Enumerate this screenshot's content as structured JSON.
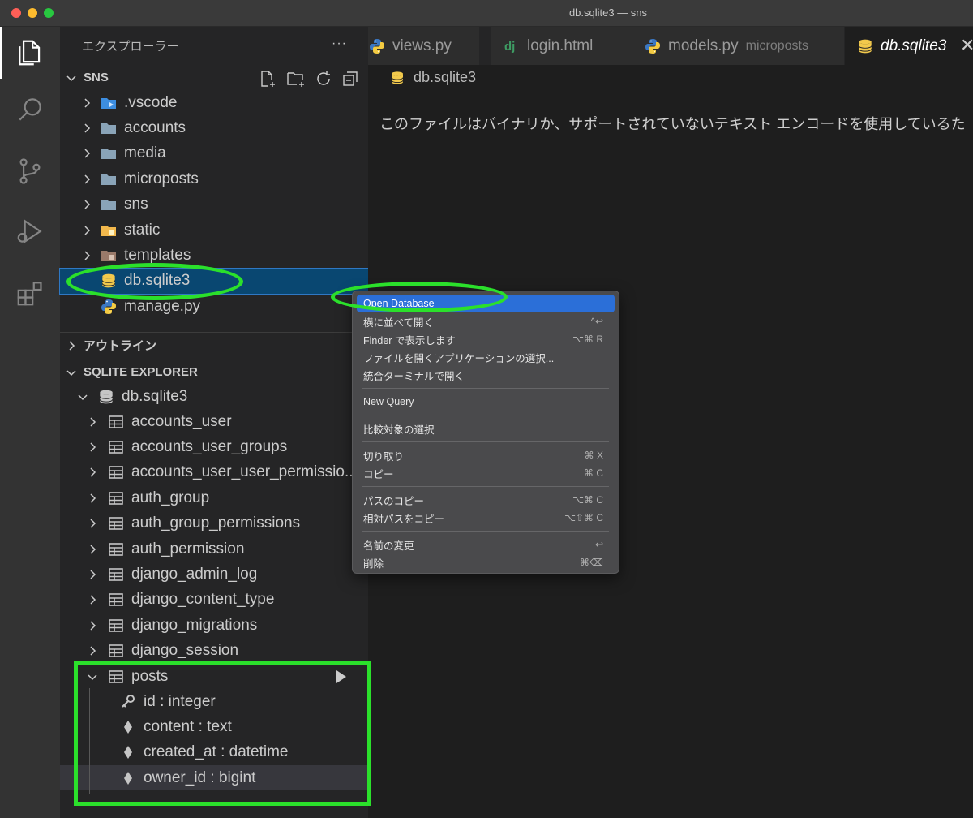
{
  "window": {
    "title": "db.sqlite3 — sns"
  },
  "sidebar": {
    "explorer_title": "エクスプローラー",
    "more": "···",
    "workspace": "SNS",
    "tree": [
      {
        "label": ".vscode",
        "kind": "folder-vscode"
      },
      {
        "label": "accounts",
        "kind": "folder"
      },
      {
        "label": "media",
        "kind": "folder"
      },
      {
        "label": "microposts",
        "kind": "folder"
      },
      {
        "label": "sns",
        "kind": "folder"
      },
      {
        "label": "static",
        "kind": "folder-static"
      },
      {
        "label": "templates",
        "kind": "folder-templates"
      },
      {
        "label": "db.sqlite3",
        "kind": "database",
        "selected": true
      },
      {
        "label": "manage.py",
        "kind": "python"
      }
    ],
    "outline_title": "アウトライン",
    "sqlite": {
      "title": "SQLITE EXPLORER",
      "database": "db.sqlite3",
      "tables": [
        "accounts_user",
        "accounts_user_groups",
        "accounts_user_user_permissio...",
        "auth_group",
        "auth_group_permissions",
        "auth_permission",
        "django_admin_log",
        "django_content_type",
        "django_migrations",
        "django_session"
      ],
      "expanded_table": "posts",
      "columns": [
        {
          "label": "id : integer",
          "icon": "key"
        },
        {
          "label": "content : text",
          "icon": "diamond"
        },
        {
          "label": "created_at : datetime",
          "icon": "diamond"
        },
        {
          "label": "owner_id : bigint",
          "icon": "diamond"
        }
      ]
    }
  },
  "tabs": [
    {
      "label": "views.py",
      "icon": "python"
    },
    {
      "label": "login.html",
      "icon": "django"
    },
    {
      "label": "models.py",
      "icon": "python",
      "desc": "microposts"
    },
    {
      "label": "db.sqlite3",
      "icon": "database",
      "active": true
    }
  ],
  "editor": {
    "breadcrumb": "db.sqlite3",
    "message": "このファイルはバイナリか、サポートされていないテキスト エンコードを使用しているた"
  },
  "context_menu": {
    "groups": [
      [
        {
          "label": "Open Database",
          "shortcut": "",
          "highlighted": true
        },
        {
          "label": "横に並べて開く",
          "shortcut": "^↩"
        },
        {
          "label": "Finder で表示します",
          "shortcut": "⌥⌘ R"
        },
        {
          "label": "ファイルを開くアプリケーションの選択...",
          "shortcut": ""
        },
        {
          "label": "統合ターミナルで開く",
          "shortcut": ""
        }
      ],
      [
        {
          "label": "New Query",
          "shortcut": ""
        }
      ],
      [
        {
          "label": "比較対象の選択",
          "shortcut": ""
        }
      ],
      [
        {
          "label": "切り取り",
          "shortcut": "⌘ X"
        },
        {
          "label": "コピー",
          "shortcut": "⌘ C"
        }
      ],
      [
        {
          "label": "パスのコピー",
          "shortcut": "⌥⌘ C"
        },
        {
          "label": "相対パスをコピー",
          "shortcut": "⌥⇧⌘ C"
        }
      ],
      [
        {
          "label": "名前の変更",
          "shortcut": "↩"
        },
        {
          "label": "削除",
          "shortcut": "⌘⌫"
        }
      ]
    ]
  },
  "colors": {
    "annotation": "#2be02b",
    "menu_highlight": "#2b6fd8",
    "selection": "#094771"
  }
}
